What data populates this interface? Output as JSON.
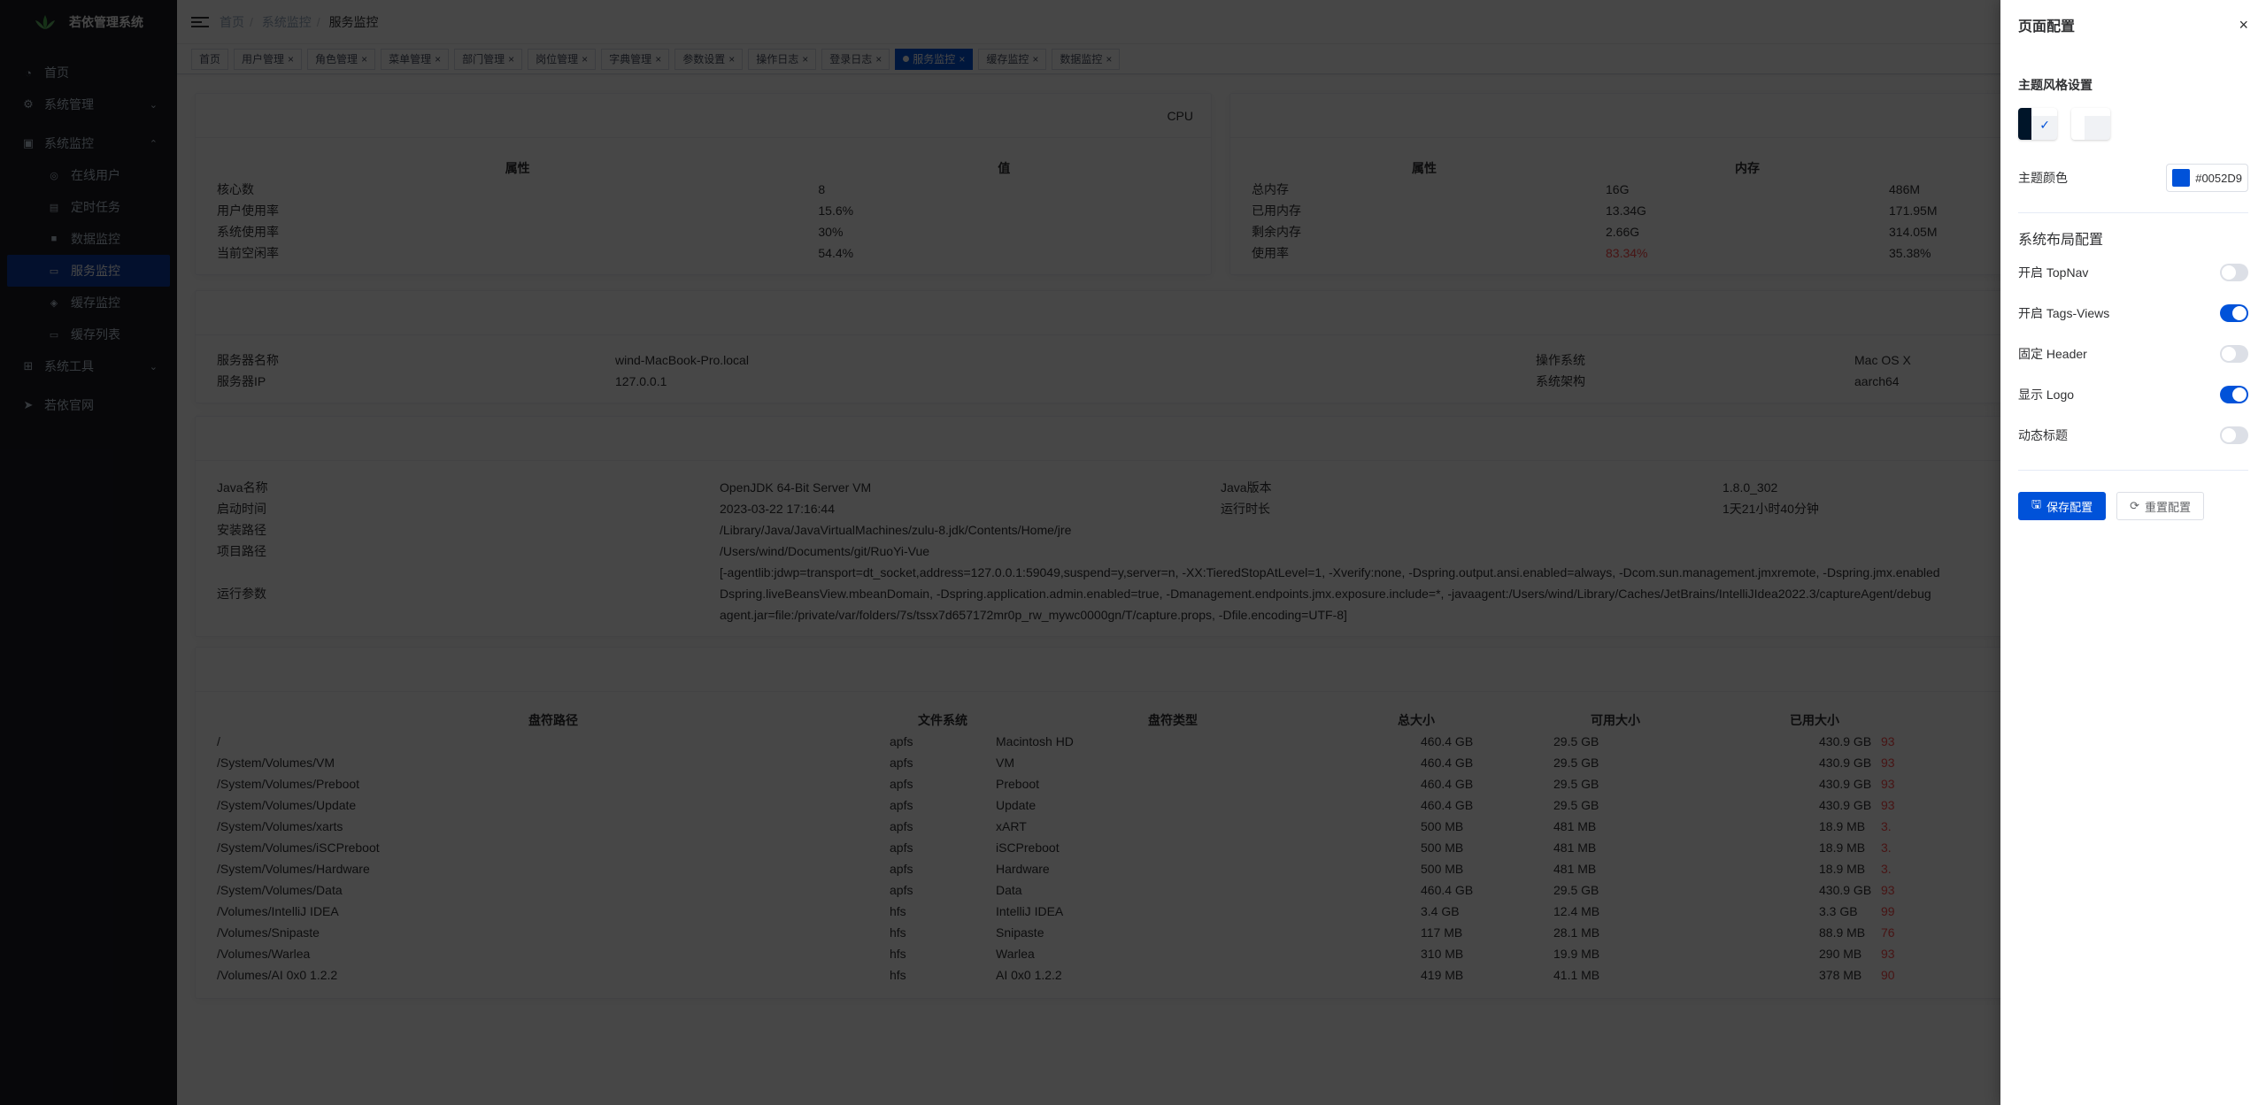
{
  "app": {
    "title": "若依管理系统"
  },
  "sidebar": {
    "items": [
      {
        "label": "首页"
      },
      {
        "label": "系统管理"
      },
      {
        "label": "系统监控"
      },
      {
        "label": "系统工具"
      },
      {
        "label": "若依官网"
      }
    ],
    "monitor_sub": [
      {
        "label": "在线用户"
      },
      {
        "label": "定时任务"
      },
      {
        "label": "数据监控"
      },
      {
        "label": "服务监控"
      },
      {
        "label": "缓存监控"
      },
      {
        "label": "缓存列表"
      }
    ]
  },
  "breadcrumb": [
    "首页",
    "系统监控",
    "服务监控"
  ],
  "tags": [
    "首页",
    "用户管理",
    "角色管理",
    "菜单管理",
    "部门管理",
    "岗位管理",
    "字典管理",
    "参数设置",
    "操作日志",
    "登录日志",
    "服务监控",
    "缓存监控",
    "数据监控"
  ],
  "cpu": {
    "title": "CPU",
    "headers": [
      "属性",
      "值"
    ],
    "rows": [
      [
        "核心数",
        "8"
      ],
      [
        "用户使用率",
        "15.6%"
      ],
      [
        "系统使用率",
        "30%"
      ],
      [
        "当前空闲率",
        "54.4%"
      ]
    ]
  },
  "mem": {
    "headers": [
      "属性",
      "内存"
    ],
    "rows": [
      [
        "总内存",
        "16G",
        "486M"
      ],
      [
        "已用内存",
        "13.34G",
        "171.95M"
      ],
      [
        "剩余内存",
        "2.66G",
        "314.05M"
      ],
      [
        "使用率",
        "83.34%",
        "35.38%"
      ]
    ]
  },
  "server": {
    "rows": [
      [
        "服务器名称",
        "wind-MacBook-Pro.local",
        "操作系统",
        "Mac OS X"
      ],
      [
        "服务器IP",
        "127.0.0.1",
        "系统架构",
        "aarch64"
      ]
    ]
  },
  "jvm": {
    "name_label": "Java名称",
    "name": "OpenJDK 64-Bit Server VM",
    "ver_label": "Java版本",
    "ver": "1.8.0_302",
    "start_label": "启动时间",
    "start": "2023-03-22 17:16:44",
    "run_label": "运行时长",
    "run": "1天21小时40分钟",
    "install_label": "安装路径",
    "install": "/Library/Java/JavaVirtualMachines/zulu-8.jdk/Contents/Home/jre",
    "project_label": "项目路径",
    "project": "/Users/wind/Documents/git/RuoYi-Vue",
    "args_label": "运行参数",
    "args1": "[-agentlib:jdwp=transport=dt_socket,address=127.0.0.1:59049,suspend=y,server=n, -XX:TieredStopAtLevel=1, -Xverify:none, -Dspring.output.ansi.enabled=always, -Dcom.sun.management.jmxremote, -Dspring.jmx.enabled",
    "args2": "Dspring.liveBeansView.mbeanDomain, -Dspring.application.admin.enabled=true, -Dmanagement.endpoints.jmx.exposure.include=*, -javaagent:/Users/wind/Library/Caches/JetBrains/IntelliJIdea2022.3/captureAgent/debug",
    "args3": "agent.jar=file:/private/var/folders/7s/tssx7d657172mr0p_rw_mywc0000gn/T/capture.props, -Dfile.encoding=UTF-8]"
  },
  "disk": {
    "headers": [
      "盘符路径",
      "文件系统",
      "盘符类型",
      "总大小",
      "可用大小",
      "已用大小"
    ],
    "rows": [
      [
        "/",
        "apfs",
        "Macintosh HD",
        "460.4 GB",
        "29.5 GB",
        "430.9 GB",
        "93"
      ],
      [
        "/System/Volumes/VM",
        "apfs",
        "VM",
        "460.4 GB",
        "29.5 GB",
        "430.9 GB",
        "93"
      ],
      [
        "/System/Volumes/Preboot",
        "apfs",
        "Preboot",
        "460.4 GB",
        "29.5 GB",
        "430.9 GB",
        "93"
      ],
      [
        "/System/Volumes/Update",
        "apfs",
        "Update",
        "460.4 GB",
        "29.5 GB",
        "430.9 GB",
        "93"
      ],
      [
        "/System/Volumes/xarts",
        "apfs",
        "xART",
        "500 MB",
        "481 MB",
        "18.9 MB",
        "3."
      ],
      [
        "/System/Volumes/iSCPreboot",
        "apfs",
        "iSCPreboot",
        "500 MB",
        "481 MB",
        "18.9 MB",
        "3."
      ],
      [
        "/System/Volumes/Hardware",
        "apfs",
        "Hardware",
        "500 MB",
        "481 MB",
        "18.9 MB",
        "3."
      ],
      [
        "/System/Volumes/Data",
        "apfs",
        "Data",
        "460.4 GB",
        "29.5 GB",
        "430.9 GB",
        "93"
      ],
      [
        "/Volumes/IntelliJ IDEA",
        "hfs",
        "IntelliJ IDEA",
        "3.4 GB",
        "12.4 MB",
        "3.3 GB",
        "99"
      ],
      [
        "/Volumes/Snipaste",
        "hfs",
        "Snipaste",
        "117 MB",
        "28.1 MB",
        "88.9 MB",
        "76"
      ],
      [
        "/Volumes/Warlea",
        "hfs",
        "Warlea",
        "310 MB",
        "19.9 MB",
        "290 MB",
        "93"
      ],
      [
        "/Volumes/AI 0x0 1.2.2",
        "hfs",
        "AI 0x0 1.2.2",
        "419 MB",
        "41.1 MB",
        "378 MB",
        "90"
      ]
    ]
  },
  "drawer": {
    "title": "页面配置",
    "close": "×",
    "theme_section": "主题风格设置",
    "theme_check": "✓",
    "theme_color_label": "主题颜色",
    "theme_color_value": "#0052D9",
    "layout_section": "系统布局配置",
    "switches": [
      {
        "label": "开启 TopNav",
        "on": false
      },
      {
        "label": "开启 Tags-Views",
        "on": true
      },
      {
        "label": "固定 Header",
        "on": false
      },
      {
        "label": "显示 Logo",
        "on": true
      },
      {
        "label": "动态标题",
        "on": false
      }
    ],
    "save_label": "保存配置",
    "reset_label": "重置配置"
  },
  "colors": {
    "accent": "#0052d9",
    "sidebar_bg": "#191a23",
    "danger": "#ff4949"
  }
}
